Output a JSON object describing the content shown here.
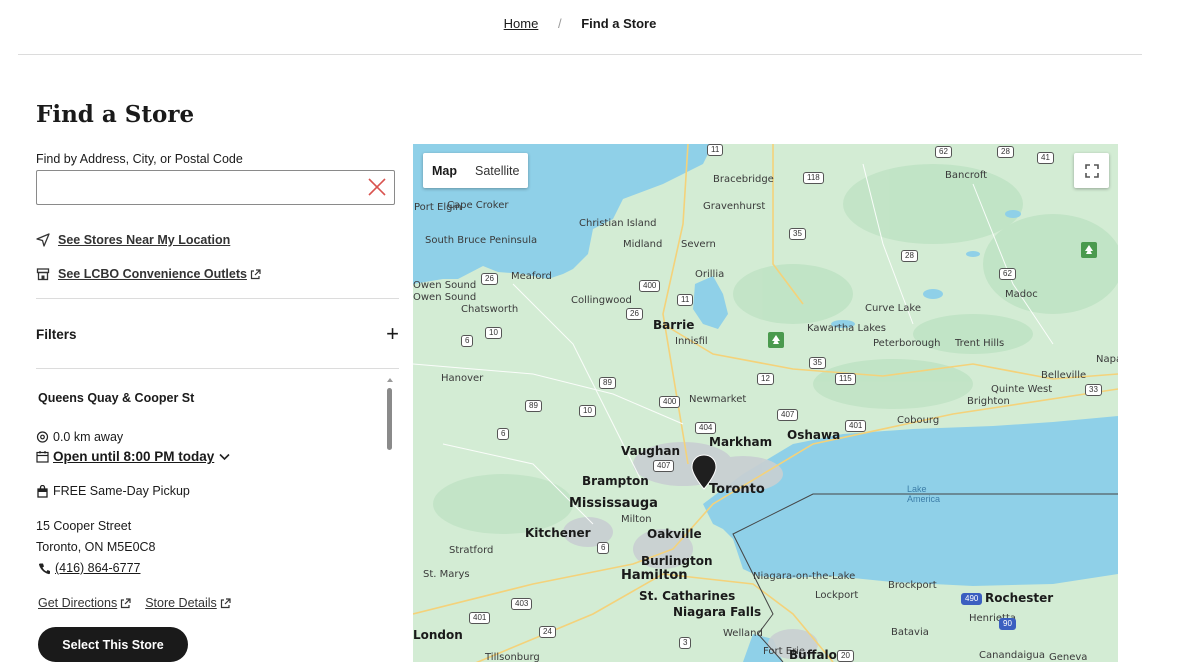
{
  "breadcrumb": {
    "home": "Home",
    "separator": "/",
    "current": "Find a Store"
  },
  "page_title": "Find a Store",
  "search": {
    "label": "Find by Address, City, or Postal Code",
    "value": "",
    "placeholder": ""
  },
  "links": {
    "near_me": "See Stores Near My Location",
    "convenience": "See LCBO Convenience Outlets"
  },
  "filters": {
    "label": "Filters",
    "toggle": "+"
  },
  "store": {
    "name": "Queens Quay & Cooper St",
    "distance": "0.0 km away",
    "hours": "Open until 8:00 PM today",
    "pickup": "FREE Same-Day Pickup",
    "address_line1": "15 Cooper Street",
    "address_line2": "Toronto, ON M5E0C8",
    "phone": "(416) 864-6777",
    "directions": "Get Directions",
    "details": "Store Details",
    "select_button": "Select This Store"
  },
  "map": {
    "toggle": {
      "map": "Map",
      "satellite": "Satellite",
      "active": "Map"
    },
    "colors": {
      "land": "#d3ecd4",
      "water": "#8fd0e8",
      "lake": "#79c7e6"
    },
    "cities": [
      "Bracebridge",
      "Gravenhurst",
      "Bancroft",
      "Port Elgin",
      "Cape Croker",
      "Christian Island",
      "Midland",
      "Severn",
      "South Bruce Peninsula",
      "Meaford",
      "Orillia",
      "Owen Sound",
      "Owen Sound",
      "Collingwood",
      "Madoc",
      "Chatsworth",
      "Barrie",
      "Curve Lake",
      "Kawartha Lakes",
      "Innisfil",
      "Peterborough",
      "Trent Hills",
      "Hanover",
      "Belleville",
      "Quinte West",
      "Brighton",
      "Newmarket",
      "Cobourg",
      "Vaughan",
      "Markham",
      "Oshawa",
      "Brampton",
      "Toronto",
      "Mississauga",
      "Milton",
      "Kitchener",
      "Oakville",
      "Stratford",
      "Burlington",
      "Hamilton",
      "St. Marys",
      "Niagara-on-the-Lake",
      "Brockport",
      "St. Catharines",
      "Lockport",
      "Rochester",
      "Niagara Falls",
      "Henrietta",
      "London",
      "Welland",
      "Batavia",
      "Fort Erie",
      "Buffalo",
      "Tillsonburg",
      "Canandaigua",
      "Geneva",
      "Napanee"
    ],
    "water_labels": [
      "Lake",
      "America"
    ],
    "shields": [
      "11",
      "62",
      "28",
      "41",
      "118",
      "35",
      "28",
      "62",
      "26",
      "400",
      "11",
      "26",
      "10",
      "6",
      "35",
      "12",
      "115",
      "89",
      "400",
      "89",
      "10",
      "407",
      "401",
      "404",
      "6",
      "407",
      "6",
      "403",
      "401",
      "24",
      "3",
      "20",
      "490",
      "90",
      "33"
    ]
  }
}
